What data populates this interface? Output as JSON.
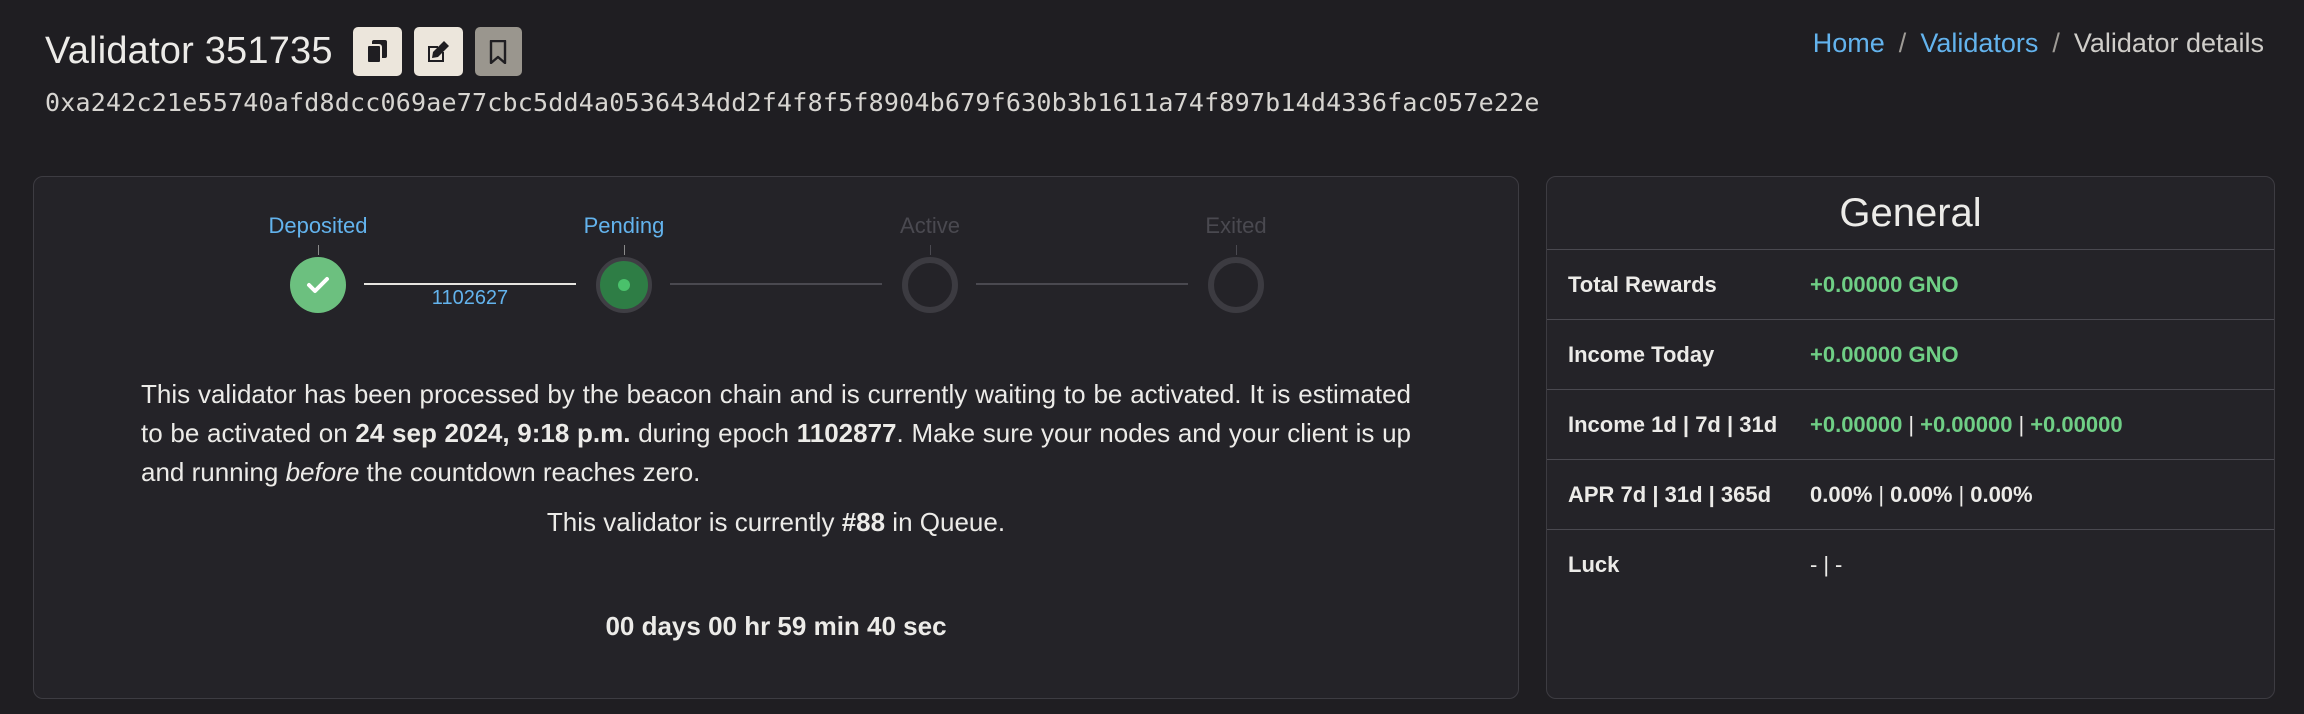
{
  "header": {
    "title": "Validator 351735",
    "pubkey": "0xa242c21e55740afd8dcc069ae77cbc5dd4a0536434dd2f4f8f5f8904b679f630b3b1611a74f897b14d4336fac057e22e",
    "buttons": [
      {
        "icon": "copy-icon"
      },
      {
        "icon": "edit-icon"
      },
      {
        "icon": "bookmark-icon"
      }
    ]
  },
  "breadcrumb": {
    "home": "Home",
    "validators": "Validators",
    "current": "Validator details",
    "separator": "/"
  },
  "stepper": {
    "steps": [
      "Deposited",
      "Pending",
      "Active",
      "Exited"
    ],
    "deposit_epoch": "1102627"
  },
  "status": {
    "text_1": "This validator has been processed by the beacon chain and is currently waiting to be activated. It is estimated to be activated on ",
    "activation_time": "24 sep 2024, 9:18 p.m.",
    "text_2": " during epoch ",
    "activation_epoch": "1102877",
    "text_3": ". Make sure your nodes and your client is up and running ",
    "emphasis": "before",
    "text_4": " the countdown reaches zero.",
    "queue_prefix": "This validator is currently ",
    "queue_position": "#88",
    "queue_suffix": " in Queue.",
    "countdown": "00 days 00 hr 59 min 40 sec"
  },
  "general": {
    "title": "General",
    "total_rewards_label": "Total Rewards",
    "total_rewards": "+0.00000 GNO",
    "income_today_label": "Income Today",
    "income_today": "+0.00000 GNO",
    "income_periods_label": "Income 1d | 7d | 31d",
    "income_1d": "+0.00000",
    "income_7d": "+0.00000",
    "income_31d": "+0.00000",
    "apr_label": "APR 7d | 31d | 365d",
    "apr_7d": "0.00%",
    "apr_31d": "0.00%",
    "apr_365d": "0.00%",
    "luck_label": "Luck",
    "luck_a": "-",
    "luck_b": "-",
    "separator": "|"
  },
  "colors": {
    "background": "#1f1e22",
    "link": "#63b3ed",
    "positive": "#6fcf85"
  }
}
